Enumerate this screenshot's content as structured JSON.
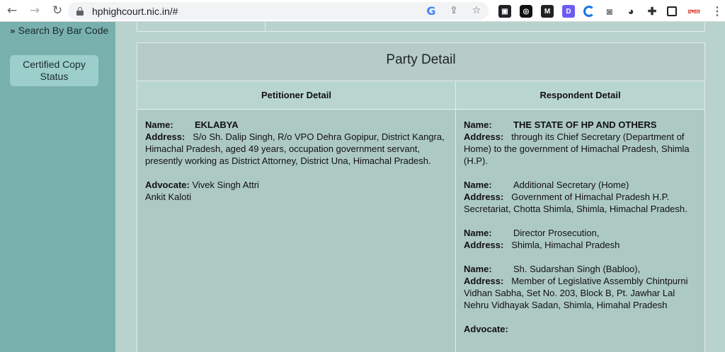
{
  "browser": {
    "url": "hphighcourt.nic.in/#",
    "ext_badge_text": "प्रभात"
  },
  "sidebar": {
    "search_link": "Search By Bar Code",
    "certified_button": "Certified Copy Status"
  },
  "party": {
    "title": "Party Detail",
    "petitioner_header": "Petitioner Detail",
    "respondent_header": "Respondent Detail",
    "name_label": "Name:",
    "address_label": "Address:",
    "advocate_label": "Advocate:",
    "petitioner": {
      "name": "EKLABYA",
      "address": "S/o Sh. Dalip Singh, R/o VPO Dehra Gopipur, District Kangra, Himachal Pradesh, aged 49 years, occupation government servant, presently working as District Attorney, District Una, Himachal Pradesh.",
      "advocates": [
        "Vivek Singh Attri",
        "Ankit Kaloti"
      ]
    },
    "respondents": [
      {
        "name": "THE STATE OF HP AND OTHERS",
        "address": "through its Chief Secretary (Department of Home) to the government of Himachal Pradesh, Shimla (H.P)."
      },
      {
        "name": "Additional Secretary (Home)",
        "address": "Government of Himachal Pradesh H.P. Secretariat, Chotta Shimla, Shimla, Himachal Pradesh."
      },
      {
        "name": "Director Prosecution,",
        "address": "Shimla, Himachal Pradesh"
      },
      {
        "name": "Sh. Sudarshan Singh (Babloo),",
        "address": "Member of Legislative Assembly Chintpurni Vidhan Sabha, Set No. 203, Block B, Pt. Jawhar Lal Nehru Vidhayak Sadan, Shimla, Himahal Pradesh"
      }
    ]
  }
}
